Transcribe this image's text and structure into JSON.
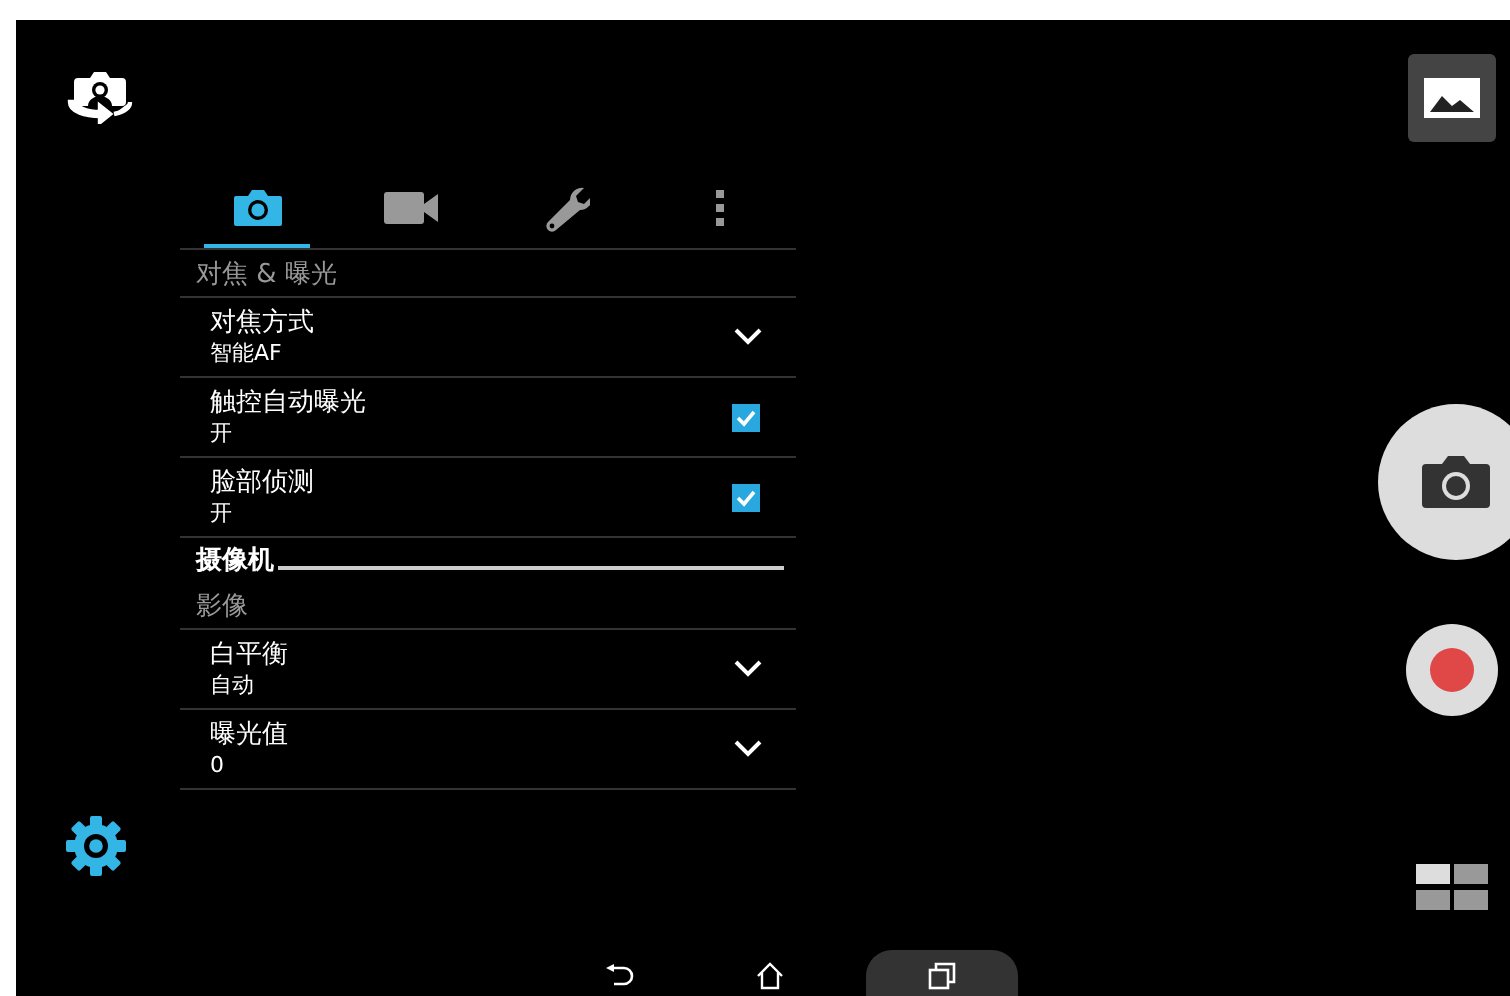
{
  "tabs": [
    {
      "kind": "camera",
      "selected": true
    },
    {
      "kind": "video",
      "selected": false
    },
    {
      "kind": "tools",
      "selected": false
    },
    {
      "kind": "more",
      "selected": false
    }
  ],
  "settings": [
    {
      "kind": "category",
      "title": "对焦 & 曝光"
    },
    {
      "kind": "dropdown",
      "title": "对焦方式",
      "value": "智能AF"
    },
    {
      "kind": "checkbox",
      "title": "触控自动曝光",
      "value": "开",
      "checked": true
    },
    {
      "kind": "checkbox",
      "title": "脸部侦测",
      "value": "开",
      "checked": true
    },
    {
      "kind": "header",
      "title": "摄像机"
    },
    {
      "kind": "category",
      "title": "影像"
    },
    {
      "kind": "dropdown",
      "title": "白平衡",
      "value": "自动"
    },
    {
      "kind": "dropdown",
      "title": "曝光值",
      "value": "0"
    }
  ]
}
